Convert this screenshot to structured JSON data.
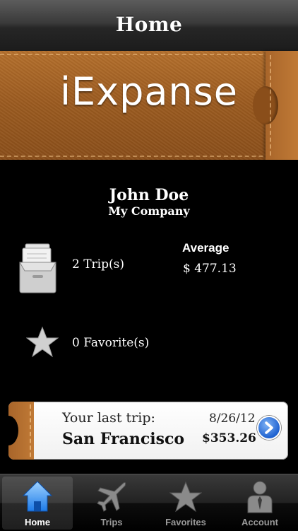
{
  "nav": {
    "title": "Home"
  },
  "banner": {
    "app_name": "iExpanse"
  },
  "profile": {
    "name": "John Doe",
    "company": "My Company"
  },
  "stats": {
    "trips_label": "2 Trip(s)",
    "average_label": "Average",
    "average_value": "$ 477.13",
    "favorites_label": "0 Favorite(s)",
    "trips_icon": "archive-box-icon",
    "favorites_icon": "star-icon"
  },
  "last_trip": {
    "heading": "Your last trip:",
    "destination": "San Francisco",
    "date": "8/26/12",
    "amount": "$353.26",
    "detail_icon": "chevron-right-circle-icon"
  },
  "tabs": [
    {
      "label": "Home",
      "icon": "home-icon",
      "active": true
    },
    {
      "label": "Trips",
      "icon": "airplane-icon",
      "active": false
    },
    {
      "label": "Favorites",
      "icon": "star-icon",
      "active": false
    },
    {
      "label": "Account",
      "icon": "person-icon",
      "active": false
    }
  ],
  "colors": {
    "accent_blue": "#2e7be0",
    "leather": "#a8652a",
    "background": "#000000"
  }
}
